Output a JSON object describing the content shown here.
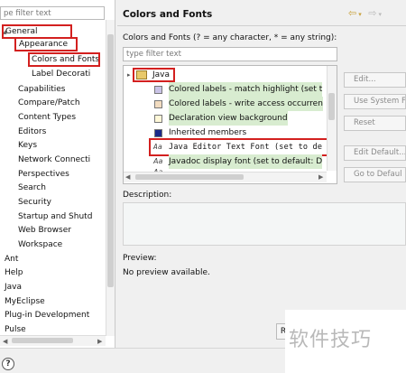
{
  "left_tree": {
    "filter_placeholder": "pe filter text",
    "items": [
      "General",
      "Appearance",
      "Colors and Fonts",
      "Label Decorati",
      "Capabilities",
      "Compare/Patch",
      "Content Types",
      "Editors",
      "Keys",
      "Network Connecti",
      "Perspectives",
      "Search",
      "Security",
      "Startup and Shutd",
      "Web Browser",
      "Workspace",
      "Ant",
      "Help",
      "Java",
      "MyEclipse",
      "Plug-in Development",
      "Pulse"
    ]
  },
  "page": {
    "title": "Colors and Fonts",
    "filter_label": "Colors and Fonts (? = any character, * = any string):",
    "filter_placeholder": "type filter text",
    "java_group": "Java",
    "entries": [
      "Colored labels - match highlight (set t",
      "Colored labels - write access occurren",
      "Declaration view background",
      "Inherited members",
      "Java Editor Text Font (set to de",
      "Javadoc display font (set to default: D"
    ],
    "buttons": [
      "Edit...",
      "Use System Fo",
      "Reset",
      "Edit Default...",
      "Go to Defaul"
    ],
    "description_label": "Description:",
    "preview_label": "Preview:",
    "preview_text": "No preview available.",
    "partial_button": "R"
  },
  "bottom": {
    "help_icon": "?"
  },
  "watermark": "软件技巧",
  "colors": {
    "highlight_box": "#d3201f",
    "entry_highlight": "#d8ecd0"
  }
}
